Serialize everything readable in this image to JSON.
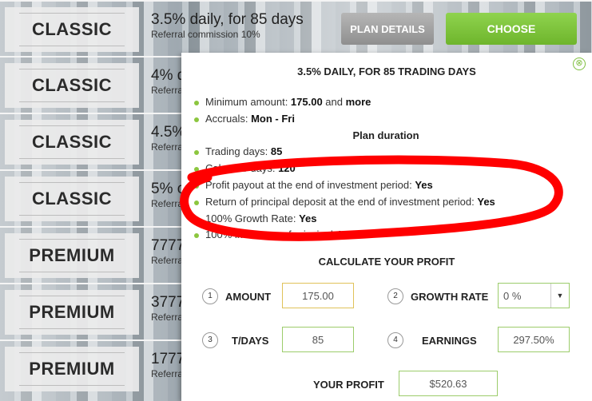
{
  "plans": [
    {
      "name": "CLASSIC",
      "headline": "3.5% daily, for 85 days",
      "sub": "Referral commission 10%"
    },
    {
      "name": "CLASSIC",
      "headline": "4% d",
      "sub": "Referra"
    },
    {
      "name": "CLASSIC",
      "headline": "4.5%",
      "sub": "Referra"
    },
    {
      "name": "CLASSIC",
      "headline": "5% c",
      "sub": "Referra"
    },
    {
      "name": "PREMIUM",
      "headline": "7777",
      "sub": "Referra"
    },
    {
      "name": "PREMIUM",
      "headline": "3777",
      "sub": "Referra"
    },
    {
      "name": "PREMIUM",
      "headline": "1777",
      "sub": "Referra"
    }
  ],
  "buttons": {
    "details": "PLAN DETAILS",
    "choose": "CHOOSE"
  },
  "popup": {
    "close_icon": "⊗",
    "title": "3.5% DAILY, FOR 85 TRADING DAYS",
    "min_label": "Minimum amount: ",
    "min_value": "175.00",
    "min_tail": " and ",
    "min_more": "more",
    "accruals_label": "Accruals:  ",
    "accruals_value": "Mon - Fri",
    "duration_head": "Plan duration",
    "trading_label": "Trading days: ",
    "trading_value": "85",
    "calendar_label": "Calendar days: ",
    "calendar_value": "120",
    "profit_label": "Profit payout at the end of investment period: ",
    "profit_value": "Yes",
    "principal_label": "Return of principal deposit at the end of investment period: ",
    "principal_value": "Yes",
    "growth_label": "100% Growth Rate: ",
    "growth_value": "Yes",
    "insurance_label": "100% insurance of principal: ",
    "insurance_value": "Yes"
  },
  "calc": {
    "title": "CALCULATE YOUR PROFIT",
    "n1": "1",
    "amount_label": "AMOUNT",
    "amount_value": "175.00",
    "n2": "2",
    "growth_label": "GROWTH RATE",
    "growth_value": "0 %",
    "growth_arrow": "▼",
    "n3": "3",
    "tdays_label": "T/DAYS",
    "tdays_value": "85",
    "n4": "4",
    "earnings_label": "EARNINGS",
    "earnings_value": "297.50%",
    "profit_label": "YOUR PROFIT",
    "profit_value": "$520.63"
  },
  "colors": {
    "accent_green": "#8cc63f",
    "annotation_red": "#ff0000"
  }
}
